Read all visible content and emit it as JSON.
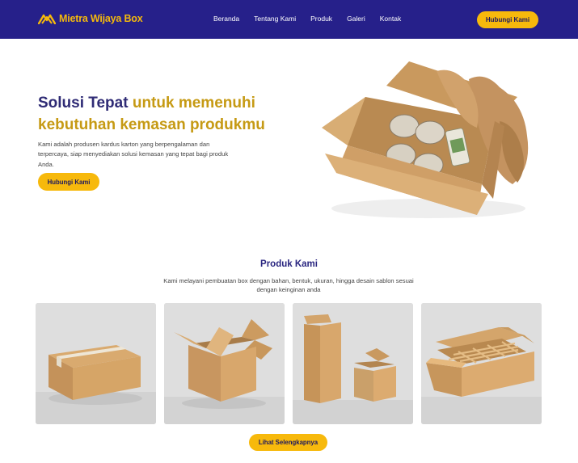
{
  "brand": {
    "name": "Mietra Wijaya Box",
    "logo_icon": "mountain-logo-icon"
  },
  "nav": {
    "links": [
      "Beranda",
      "Tentang Kami",
      "Produk",
      "Galeri",
      "Kontak"
    ],
    "cta_label": "Hubungi Kami"
  },
  "hero": {
    "title_part1": "Solusi Tepat",
    "title_part2": "untuk memenuhi kebutuhan kemasan produkmu",
    "description": "Kami adalah produsen kardus karton yang berpengalaman dan terpercaya, siap menyediakan solusi kemasan yang tepat bagi produk Anda.",
    "cta_label": "Hubungi Kami"
  },
  "products": {
    "title": "Produk Kami",
    "subtitle": "Kami melayani pembuatan box dengan bahan, bentuk, ukuran, hingga desain sablon sesuai dengan keinginan anda",
    "more_label": "Lihat Selengkapnya"
  },
  "colors": {
    "nav_bg": "#26208a",
    "accent": "#f7b90c",
    "title_dark": "#2f2b75",
    "title_gold": "#c69a14",
    "cardboard": "#c89b63"
  }
}
